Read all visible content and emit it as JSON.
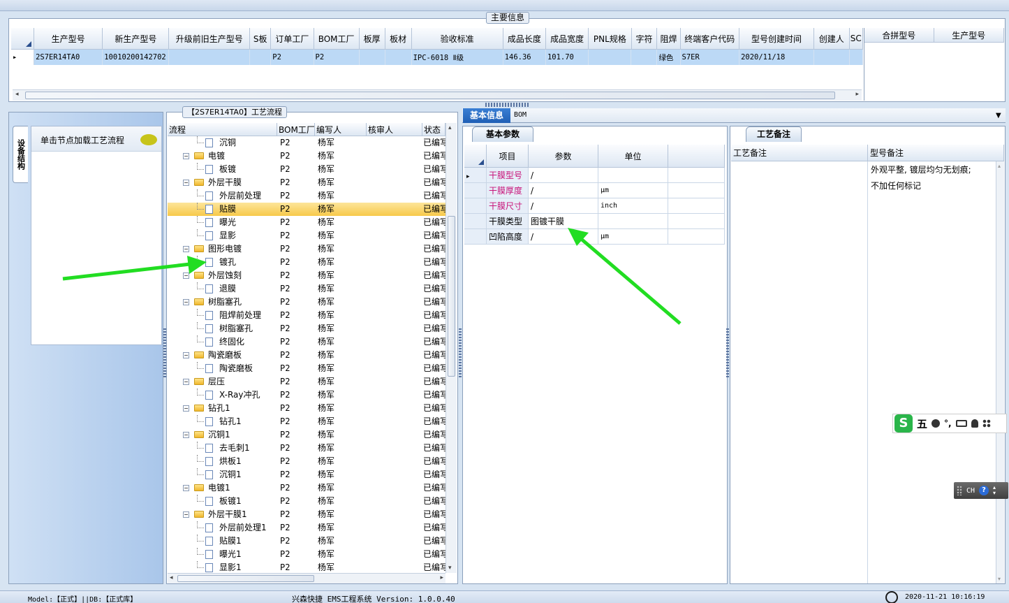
{
  "main_info": {
    "title": "主要信息",
    "columns": [
      "生产型号",
      "新生产型号",
      "升级前旧生产型号",
      "S板",
      "订单工厂",
      "BOM工厂",
      "板厚",
      "板材",
      "验收标准",
      "成品长度",
      "成品宽度",
      "PNL规格",
      "字符",
      "阻焊",
      "终端客户代码",
      "型号创建时间",
      "创建人",
      "SC"
    ],
    "row": [
      "2S7ER14TA0",
      "10010200142702",
      "",
      "",
      "P2",
      "P2",
      "",
      "",
      "IPC-6018 Ⅱ级",
      "146.36",
      "101.70",
      "",
      "",
      "绿色",
      "S7ER",
      "2020/11/18",
      "",
      ""
    ],
    "row_marker": "▸",
    "side_columns": [
      "合拼型号",
      "生产型号"
    ]
  },
  "left_panel": {
    "vertical_tab": "设备结构",
    "hint_text": "单击节点加载工艺流程"
  },
  "process_tree": {
    "title": "【2S7ER14TA0】工艺流程",
    "columns": [
      "流程",
      "BOM工厂",
      "编写人",
      "核审人",
      "状态"
    ],
    "rows": [
      {
        "label": "沉铜",
        "kind": "doc",
        "bom": "P2",
        "author": "杨军",
        "reviewer": "",
        "status": "已编写"
      },
      {
        "label": "电镀",
        "kind": "folder",
        "bom": "P2",
        "author": "杨军",
        "reviewer": "",
        "status": "已编写"
      },
      {
        "label": "板镀",
        "kind": "doc",
        "bom": "P2",
        "author": "杨军",
        "reviewer": "",
        "status": "已编写"
      },
      {
        "label": "外层干膜",
        "kind": "folder",
        "bom": "P2",
        "author": "杨军",
        "reviewer": "",
        "status": "已编写"
      },
      {
        "label": "外层前处理",
        "kind": "doc",
        "bom": "P2",
        "author": "杨军",
        "reviewer": "",
        "status": "已编写"
      },
      {
        "label": "贴膜",
        "kind": "doc",
        "bom": "P2",
        "author": "杨军",
        "reviewer": "",
        "status": "已编写",
        "selected": true
      },
      {
        "label": "曝光",
        "kind": "doc",
        "bom": "P2",
        "author": "杨军",
        "reviewer": "",
        "status": "已编写"
      },
      {
        "label": "显影",
        "kind": "doc",
        "bom": "P2",
        "author": "杨军",
        "reviewer": "",
        "status": "已编写"
      },
      {
        "label": "图形电镀",
        "kind": "folder",
        "bom": "P2",
        "author": "杨军",
        "reviewer": "",
        "status": "已编写"
      },
      {
        "label": "镀孔",
        "kind": "doc",
        "bom": "P2",
        "author": "杨军",
        "reviewer": "",
        "status": "已编写"
      },
      {
        "label": "外层蚀刻",
        "kind": "folder",
        "bom": "P2",
        "author": "杨军",
        "reviewer": "",
        "status": "已编写"
      },
      {
        "label": "退膜",
        "kind": "doc",
        "bom": "P2",
        "author": "杨军",
        "reviewer": "",
        "status": "已编写"
      },
      {
        "label": "树脂塞孔",
        "kind": "folder",
        "bom": "P2",
        "author": "杨军",
        "reviewer": "",
        "status": "已编写"
      },
      {
        "label": "阻焊前处理",
        "kind": "doc",
        "bom": "P2",
        "author": "杨军",
        "reviewer": "",
        "status": "已编写"
      },
      {
        "label": "树脂塞孔",
        "kind": "doc",
        "bom": "P2",
        "author": "杨军",
        "reviewer": "",
        "status": "已编写"
      },
      {
        "label": "终固化",
        "kind": "doc",
        "bom": "P2",
        "author": "杨军",
        "reviewer": "",
        "status": "已编写"
      },
      {
        "label": "陶瓷磨板",
        "kind": "folder",
        "bom": "P2",
        "author": "杨军",
        "reviewer": "",
        "status": "已编写"
      },
      {
        "label": "陶瓷磨板",
        "kind": "doc",
        "bom": "P2",
        "author": "杨军",
        "reviewer": "",
        "status": "已编写"
      },
      {
        "label": "层压",
        "kind": "folder",
        "bom": "P2",
        "author": "杨军",
        "reviewer": "",
        "status": "已编写"
      },
      {
        "label": "X-Ray冲孔",
        "kind": "doc",
        "bom": "P2",
        "author": "杨军",
        "reviewer": "",
        "status": "已编写"
      },
      {
        "label": "钻孔1",
        "kind": "folder",
        "bom": "P2",
        "author": "杨军",
        "reviewer": "",
        "status": "已编写"
      },
      {
        "label": "钻孔1",
        "kind": "doc",
        "bom": "P2",
        "author": "杨军",
        "reviewer": "",
        "status": "已编写"
      },
      {
        "label": "沉铜1",
        "kind": "folder",
        "bom": "P2",
        "author": "杨军",
        "reviewer": "",
        "status": "已编写"
      },
      {
        "label": "去毛刺1",
        "kind": "doc",
        "bom": "P2",
        "author": "杨军",
        "reviewer": "",
        "status": "已编写"
      },
      {
        "label": "烘板1",
        "kind": "doc",
        "bom": "P2",
        "author": "杨军",
        "reviewer": "",
        "status": "已编写"
      },
      {
        "label": "沉铜1",
        "kind": "doc",
        "bom": "P2",
        "author": "杨军",
        "reviewer": "",
        "status": "已编写"
      },
      {
        "label": "电镀1",
        "kind": "folder",
        "bom": "P2",
        "author": "杨军",
        "reviewer": "",
        "status": "已编写"
      },
      {
        "label": "板镀1",
        "kind": "doc",
        "bom": "P2",
        "author": "杨军",
        "reviewer": "",
        "status": "已编写"
      },
      {
        "label": "外层干膜1",
        "kind": "folder",
        "bom": "P2",
        "author": "杨军",
        "reviewer": "",
        "status": "已编写"
      },
      {
        "label": "外层前处理1",
        "kind": "doc",
        "bom": "P2",
        "author": "杨军",
        "reviewer": "",
        "status": "已编写"
      },
      {
        "label": "贴膜1",
        "kind": "doc",
        "bom": "P2",
        "author": "杨军",
        "reviewer": "",
        "status": "已编写"
      },
      {
        "label": "曝光1",
        "kind": "doc",
        "bom": "P2",
        "author": "杨军",
        "reviewer": "",
        "status": "已编写"
      },
      {
        "label": "显影1",
        "kind": "doc",
        "bom": "P2",
        "author": "杨军",
        "reviewer": "",
        "status": "已编写"
      }
    ]
  },
  "detail": {
    "tabs": [
      "基本信息",
      "BOM"
    ],
    "sub_tab": "基本参数",
    "columns": [
      "项目",
      "参数",
      "单位"
    ],
    "params": [
      {
        "item": "干膜型号",
        "value": "/",
        "unit": "",
        "required": true
      },
      {
        "item": "干膜厚度",
        "value": "/",
        "unit": "μm",
        "required": true
      },
      {
        "item": "干膜尺寸",
        "value": "/",
        "unit": "inch",
        "required": true
      },
      {
        "item": "干膜类型",
        "value": "图镀干膜",
        "unit": "",
        "required": false
      },
      {
        "item": "凹陷高度",
        "value": "/",
        "unit": "μm",
        "required": false
      }
    ]
  },
  "remarks": {
    "tab": "工艺备注",
    "columns": [
      "工艺备注",
      "型号备注"
    ],
    "model_note_lines": [
      "外观平整, 镀层均匀无划痕;",
      "不加任何标记"
    ]
  },
  "ime": {
    "mode_char": "五",
    "lang": "CH"
  },
  "status_bar": {
    "left": "Model:【正式】||DB:【正式库】",
    "center": "兴森快捷 EMS工程系统 Version: 1.0.0.40",
    "right": "2020-11-21 10:16:19"
  },
  "colors": {
    "accent": "#1f5fb5",
    "required": "#c8147a",
    "selected_row": "#f7c94a",
    "annotation": "#22dd22"
  }
}
